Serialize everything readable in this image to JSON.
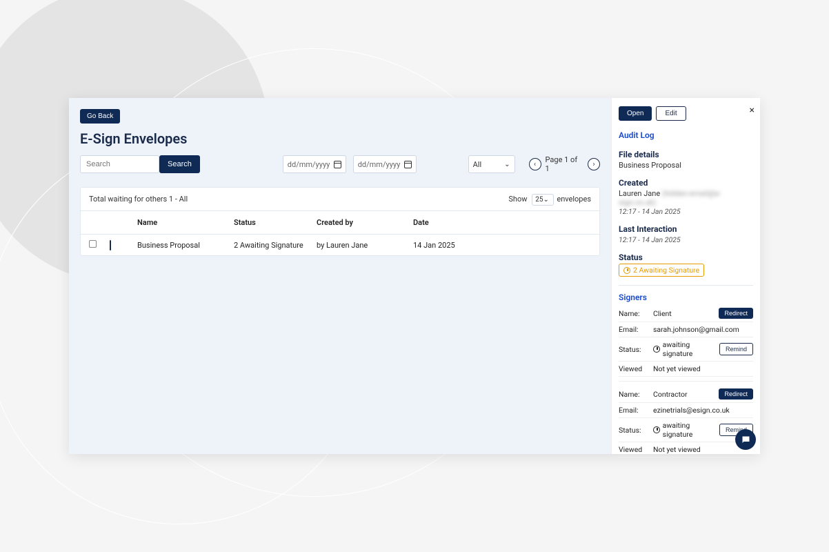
{
  "header": {
    "go_back": "Go Back",
    "title": "E-Sign Envelopes"
  },
  "search": {
    "placeholder": "Search",
    "button": "Search"
  },
  "dates": {
    "from_placeholder": "dd/mm/yyyy",
    "to_placeholder": "dd/mm/yyyy"
  },
  "filter": {
    "selected": "All"
  },
  "pager": {
    "text": "Page 1 of 1"
  },
  "table": {
    "summary": "Total waiting for others 1 - All",
    "show_label_pre": "Show",
    "show_value": "25",
    "show_label_post": "envelopes",
    "headers": {
      "name": "Name",
      "status": "Status",
      "created_by": "Created by",
      "date": "Date"
    },
    "rows": [
      {
        "name": "Business Proposal",
        "status": "2 Awaiting Signature",
        "created_by": "by Lauren Jane",
        "date": "14 Jan 2025"
      }
    ]
  },
  "side": {
    "open": "Open",
    "edit": "Edit",
    "audit_log": "Audit Log",
    "file_details_title": "File details",
    "file_name": "Business Proposal",
    "created_title": "Created",
    "created_by": "Lauren Jane",
    "created_email_masked": "(hidden-email@e-sign.co.uk)",
    "created_ts": "12:17 - 14 Jan 2025",
    "last_interaction_title": "Last Interaction",
    "last_interaction_ts": "12:17 - 14 Jan 2025",
    "status_title": "Status",
    "status_value": "2 Awaiting Signature",
    "signers_title": "Signers",
    "labels": {
      "name": "Name:",
      "email": "Email:",
      "status": "Status:",
      "viewed": "Viewed"
    },
    "signer_status_text": "awaiting signature",
    "redirect": "Redirect",
    "remind": "Remind",
    "not_viewed": "Not yet viewed",
    "signers": [
      {
        "name": "Client",
        "email": "sarah.johnson@gmail.com"
      },
      {
        "name": "Contractor",
        "email": "ezinetrials@esign.co.uk"
      }
    ]
  }
}
